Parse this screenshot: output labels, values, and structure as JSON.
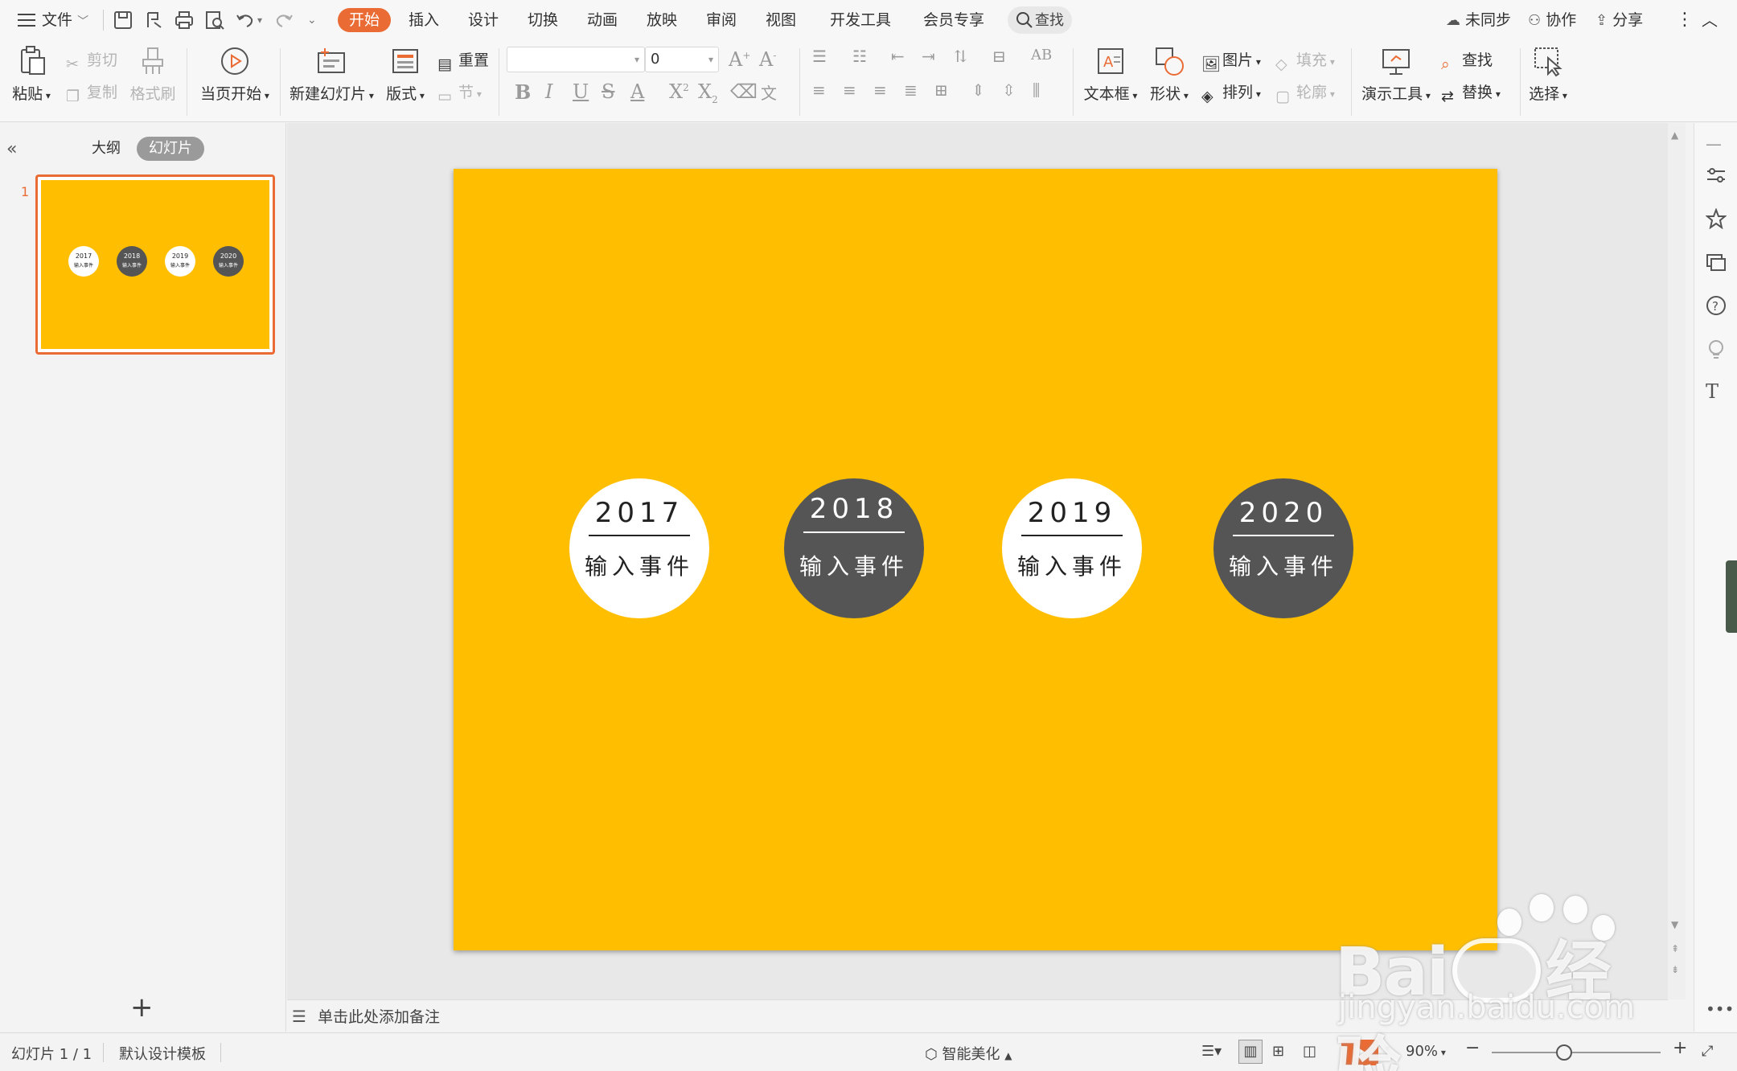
{
  "menubar": {
    "file_label": "文件",
    "tabs": [
      "开始",
      "插入",
      "设计",
      "切换",
      "动画",
      "放映",
      "审阅",
      "视图",
      "开发工具",
      "会员专享"
    ],
    "active_tab": "开始",
    "search_label": "查找",
    "sync_label": "未同步",
    "collab_label": "协作",
    "share_label": "分享"
  },
  "ribbon": {
    "paste": "粘贴",
    "cut": "剪切",
    "copy": "复制",
    "format_painter": "格式刷",
    "from_current": "当页开始",
    "new_slide": "新建幻灯片",
    "layout": "版式",
    "reset": "重置",
    "section": "节",
    "font_name": "",
    "font_size": "0",
    "text_box": "文本框",
    "shape": "形状",
    "picture": "图片",
    "fill": "填充",
    "arrange": "排列",
    "outline": "轮廓",
    "presentation_tools": "演示工具",
    "find": "查找",
    "replace": "替换",
    "select": "选择"
  },
  "left_panel": {
    "tab_outline": "大纲",
    "tab_slides": "幻灯片",
    "slide_number": "1"
  },
  "slide": {
    "background": "#ffbf00",
    "events": [
      {
        "year": "2017",
        "text": "输入事件",
        "style": "white"
      },
      {
        "year": "2018",
        "text": "输入事件",
        "style": "dark"
      },
      {
        "year": "2019",
        "text": "输入事件",
        "style": "white"
      },
      {
        "year": "2020",
        "text": "输入事件",
        "style": "dark"
      }
    ]
  },
  "notes": {
    "placeholder": "单击此处添加备注"
  },
  "statusbar": {
    "slide_counter": "幻灯片 1 / 1",
    "template": "默认设计模板",
    "smart_beautify": "智能美化",
    "zoom": "90%"
  },
  "watermark": {
    "brand": "Bai",
    "brand_suffix": "经验",
    "url": "jingyan.baidu.com"
  },
  "colors": {
    "accent": "#ea6b34",
    "slide_bg": "#ffbf00",
    "circle_dark": "#555555",
    "circle_light": "#ffffff"
  }
}
